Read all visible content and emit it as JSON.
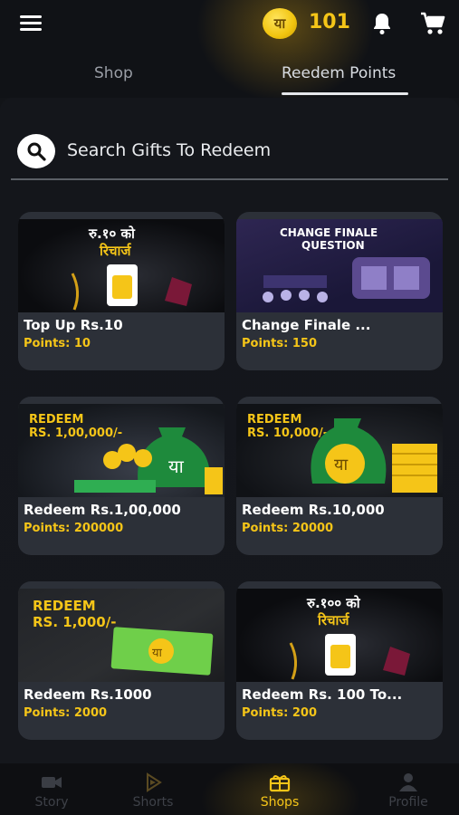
{
  "header": {
    "coin_symbol": "या",
    "points": "101"
  },
  "tabs": [
    {
      "label": "Shop"
    },
    {
      "label": "Reedem Points"
    }
  ],
  "search": {
    "placeholder": "Search Gifts To Redeem"
  },
  "gifts": [
    {
      "title": "Top Up Rs.10",
      "points": "Points: 10",
      "image_text": [
        "रु.१० को",
        "रिचार्ज"
      ]
    },
    {
      "title": "Change Finale ...",
      "points": "Points: 150",
      "image_text": [
        "CHANGE FINALE",
        "QUESTION"
      ]
    },
    {
      "title": "Redeem Rs.1,00,000",
      "points": "Points: 200000",
      "image_text": [
        "REDEEM",
        "RS. 1,00,000/-"
      ]
    },
    {
      "title": "Redeem Rs.10,000",
      "points": "Points: 20000",
      "image_text": [
        "REDEEM",
        "RS. 10,000/-"
      ]
    },
    {
      "title": "Redeem Rs.1000",
      "points": "Points: 2000",
      "image_text": [
        "REDEEM",
        "RS. 1,000/-"
      ]
    },
    {
      "title": "Redeem Rs. 100 To...",
      "points": "Points: 200",
      "image_text": [
        "रु.१०० को",
        "रिचार्ज"
      ]
    }
  ],
  "bottom_nav": [
    {
      "label": "Story",
      "icon": "video-camera-icon"
    },
    {
      "label": "Shorts",
      "icon": "shorts-icon"
    },
    {
      "label": "Shops",
      "icon": "gift-box-icon",
      "active": true
    },
    {
      "label": "Profile",
      "icon": "person-icon"
    }
  ],
  "colors": {
    "accent": "#f5c518",
    "card_bg": "#2c3038",
    "background": "#121418"
  }
}
